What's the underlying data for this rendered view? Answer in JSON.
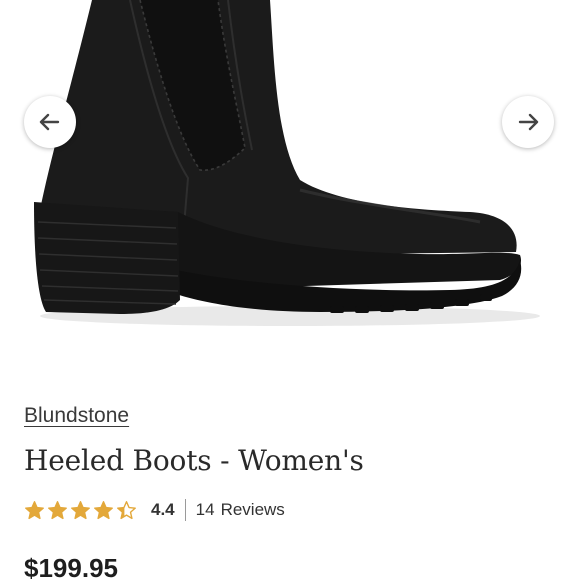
{
  "product": {
    "brand": "Blundstone",
    "title": "Heeled Boots - Women's",
    "rating": {
      "value": "4.4",
      "stars_filled": 4.4,
      "stars_max": 5,
      "review_count": "14",
      "reviews_label": "Reviews"
    },
    "price": "$199.95"
  },
  "gallery": {
    "prev_icon": "arrow-left-icon",
    "next_icon": "arrow-right-icon"
  },
  "colors": {
    "star": "#e3a83a",
    "boot": "#1a1a1a",
    "text": "#2b2b2b"
  }
}
